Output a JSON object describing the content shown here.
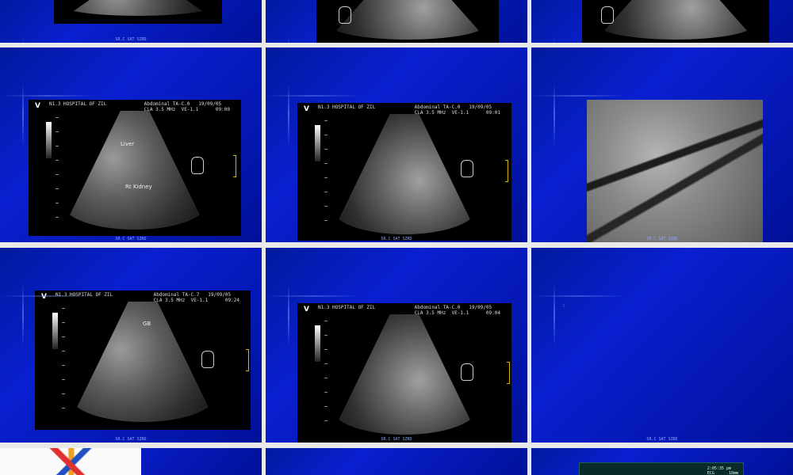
{
  "gallery": {
    "tiles": [
      {
        "id": "tile-r1c1",
        "caption": ""
      },
      {
        "id": "tile-r1c2",
        "caption": ""
      },
      {
        "id": "tile-r1c3",
        "caption": ""
      },
      {
        "id": "tile-r2c1",
        "header_left": "N1.3 HOSPITAL OF ZIL",
        "header_right": "Abdominal TA-C.0   19/09/05\nCLA 3.5 MHz  VE-1.1      09:00",
        "labels": [
          "Liver",
          "Rt Kidney"
        ]
      },
      {
        "id": "tile-r2c2",
        "header_left": "N1.3 HOSPITAL OF ZIL",
        "header_right": "Abdominal TA-C.0   19/09/05\nCLA 3.5 MHz  VE-1.1      09:01"
      },
      {
        "id": "tile-r2c3"
      },
      {
        "id": "tile-r3c1",
        "header_left": "N1.3 HOSPITAL OF ZIL",
        "header_right": "Abdominal TA-C.7   19/09/05\nCLA 3.5 MHz  VE-1.1      09:24",
        "labels": [
          "GB"
        ]
      },
      {
        "id": "tile-r3c2",
        "header_left": "N1.3 HOSPITAL OF ZIL",
        "header_right": "Abdominal TA-C.0   19/09/05\nCLA 3.5 MHz  VE-1.1      09:04"
      },
      {
        "id": "tile-r3c3"
      },
      {
        "id": "tile-r4c1"
      },
      {
        "id": "tile-r4c2"
      },
      {
        "id": "tile-r4c3",
        "ecg_text": "2:05:35 pm\nECG      18mm"
      }
    ],
    "v_mark": "V",
    "caption_text": "SR.C SAT SZRD"
  }
}
